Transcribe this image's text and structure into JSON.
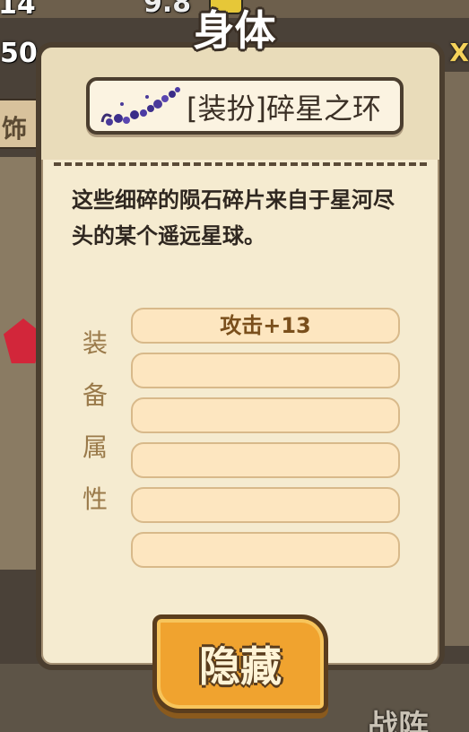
{
  "background": {
    "top_left_number": "14",
    "top_center_number": "9.8",
    "left_number": "50",
    "right_mark": "X",
    "side_tab_text": "饰",
    "bottom_text": "战阵"
  },
  "dialog": {
    "title": "身体",
    "item_name": "[装扮]碎星之环",
    "item_icon": "meteor-fragments-icon",
    "description": "这些细碎的陨石碎片来自于星河尽头的某个遥远星球。",
    "attributes_label": [
      "装",
      "备",
      "属",
      "性"
    ],
    "attributes": [
      "攻击+13",
      "",
      "",
      "",
      "",
      ""
    ],
    "hide_button": "隐藏"
  },
  "colors": {
    "panel_bg": "#f5ebd0",
    "border": "#4b3e2f",
    "slot_bg": "#fde6c0",
    "button_orange": "#f0a32f",
    "attr_text": "#7a4f1c"
  }
}
